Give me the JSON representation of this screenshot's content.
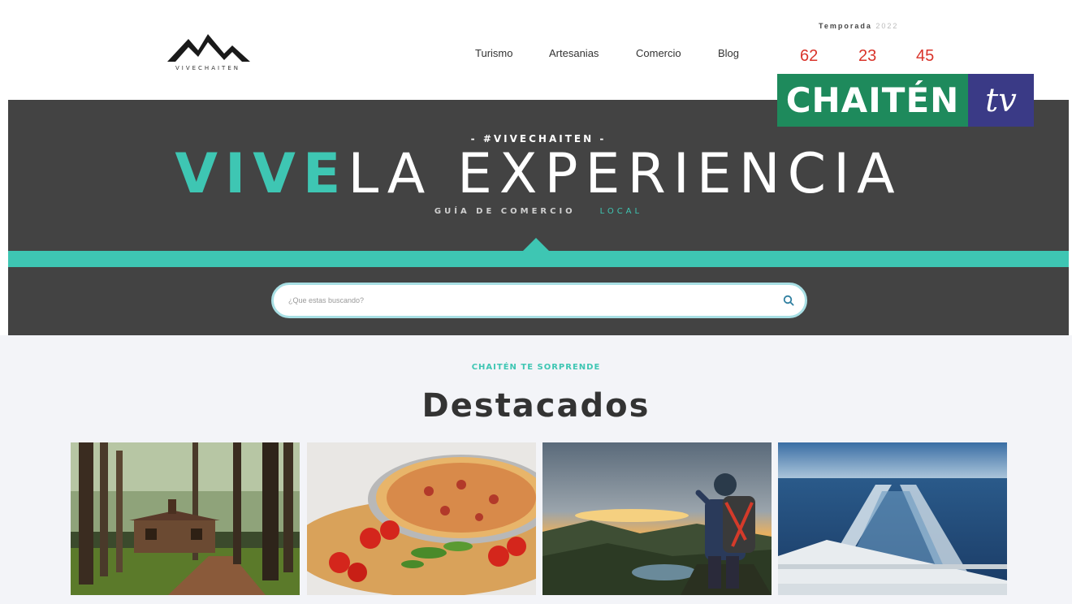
{
  "header": {
    "logo_text": "VIVECHAITEN",
    "nav": [
      {
        "label": "Turismo"
      },
      {
        "label": "Artesanias"
      },
      {
        "label": "Comercio"
      },
      {
        "label": "Blog"
      }
    ],
    "season_label": "Temporada",
    "season_year": "2022",
    "counters": [
      "62",
      "23",
      "45"
    ]
  },
  "badge": {
    "brand": "CHAITÉN",
    "suffix": "tv"
  },
  "hero": {
    "hashtag": "- #VIVECHAITEN -",
    "headline_accent": "VIVE",
    "headline_rest": "LA EXPERIENCIA",
    "subline_main": "GUÍA DE COMERCIO",
    "subline_accent": "LOCAL",
    "search_placeholder": "¿Que estas buscando?"
  },
  "featured": {
    "eyebrow": "CHAITÉN TE SORPRENDE",
    "title": "Destacados",
    "cards": [
      {
        "icon": "forest-cabin-image"
      },
      {
        "icon": "pizza-image"
      },
      {
        "icon": "hiker-sunset-image"
      },
      {
        "icon": "boat-wake-image"
      }
    ]
  },
  "colors": {
    "accent": "#3ec6b3",
    "hero_bg": "#434343",
    "counter": "#d9342b",
    "badge_green": "#1e8a5c",
    "badge_blue": "#3a3a86"
  }
}
